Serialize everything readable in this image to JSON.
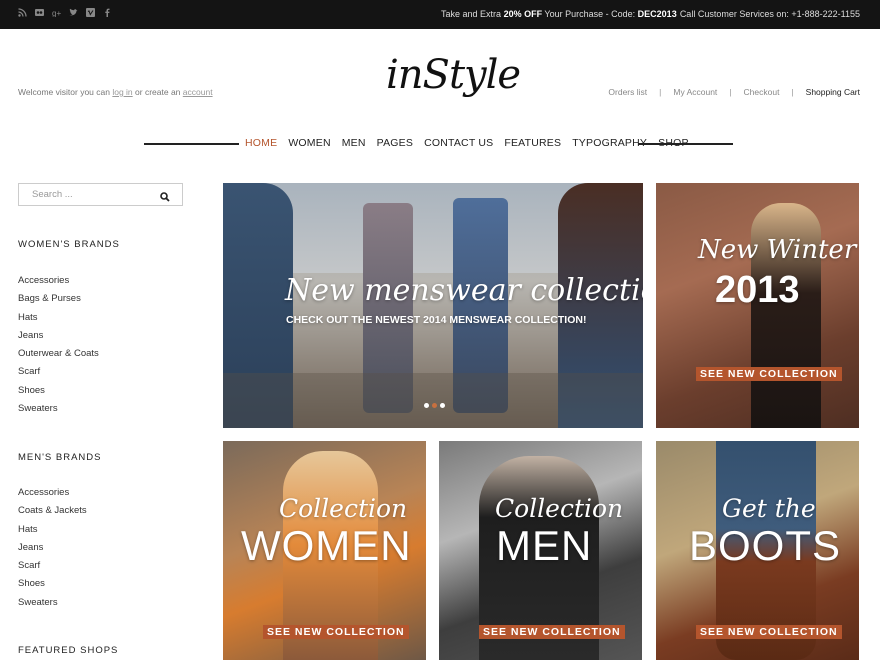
{
  "topbar": {
    "social_icons": [
      "rss-icon",
      "flickr-icon",
      "google-plus-icon",
      "twitter-icon",
      "vimeo-icon",
      "facebook-icon"
    ],
    "promo_prefix": "Take and Extra",
    "promo_highlight": "20% OFF",
    "promo_middle": "Your Purchase - Code:",
    "promo_code": "DEC2013",
    "service": "Call Customer Services on: +1-888-222-1155"
  },
  "header": {
    "welcome_prefix": "Welcome visitor you can",
    "login_link": "log in",
    "welcome_middle": "or create an",
    "account_link": "account",
    "logo": "inStyle",
    "links": {
      "orders": "Orders list",
      "my_account": "My Account",
      "checkout": "Checkout",
      "cart": "Shopping Cart",
      "separator": "|"
    }
  },
  "nav": {
    "items": [
      "HOME",
      "WOMEN",
      "MEN",
      "PAGES",
      "CONTACT US",
      "FEATURES",
      "TYPOGRAPHY",
      "SHOP"
    ],
    "active": "HOME",
    "accent_color": "#b4552d"
  },
  "sidebar": {
    "search_placeholder": "Search ...",
    "womens_heading": "WOMEN'S BRANDS",
    "womens_items": [
      "Accessories",
      "Bags & Purses",
      "Hats",
      "Jeans",
      "Outerwear & Coats",
      "Scarf",
      "Shoes",
      "Sweaters"
    ],
    "mens_heading": "MEN'S BRANDS",
    "mens_items": [
      "Accessories",
      "Coats & Jackets",
      "Hats",
      "Jeans",
      "Scarf",
      "Shoes",
      "Sweaters"
    ],
    "featured_heading": "FEATURED SHOPS"
  },
  "banners": {
    "main_script": "New menswear collection",
    "main_sub": "CHECK OUT THE NEWEST 2014 MENSWEAR COLLECTION!",
    "winter_script": "New Winter",
    "winter_year": "2013",
    "women_script": "Collection",
    "women_word": "WOMEN",
    "men_script": "Collection",
    "men_word": "MEN",
    "boots_script": "Get the",
    "boots_word": "BOOTS",
    "cta": "SEE NEW COLLECTION"
  },
  "slider": {
    "slide_count": 3,
    "active_slide": 2
  }
}
